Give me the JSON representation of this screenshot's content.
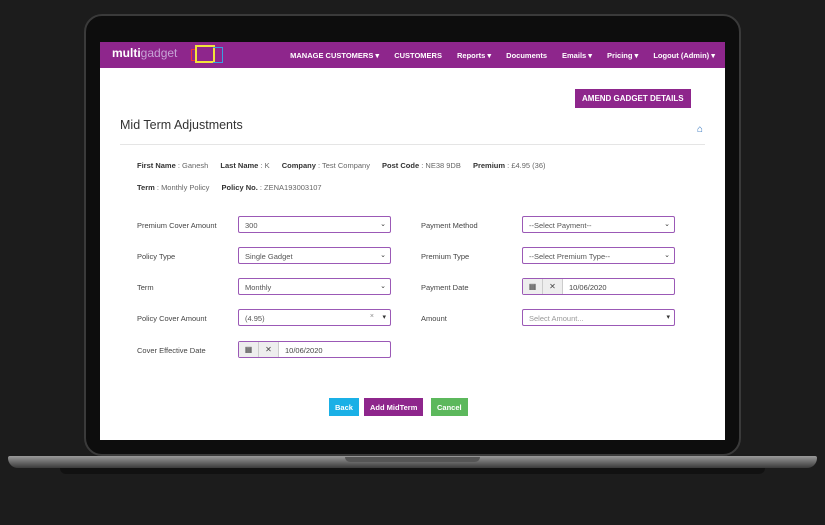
{
  "nav": {
    "logo_main": "multi",
    "logo_sub": "gadget",
    "items": [
      "MANAGE CUSTOMERS ▾",
      "CUSTOMERS",
      "Reports ▾",
      "Documents",
      "Emails ▾",
      "Pricing ▾",
      "Logout (Admin) ▾"
    ]
  },
  "amend_label": "AMEND GADGET DETAILS",
  "title": "Mid Term Adjustments",
  "info": {
    "first_name_label": "First Name",
    "first_name": "Ganesh",
    "last_name_label": "Last Name",
    "last_name": "K",
    "company_label": "Company",
    "company": "Test Company",
    "post_code_label": "Post Code",
    "post_code": "NE38 9DB",
    "premium_label": "Premium",
    "premium": "£4.95 (36)",
    "term_label": "Term",
    "term": "Monthly Policy",
    "policy_no_label": "Policy No.",
    "policy_no": "ZENA193003107"
  },
  "form": {
    "premium_cover_amount_label": "Premium Cover Amount",
    "premium_cover_amount": "300",
    "policy_type_label": "Policy Type",
    "policy_type": "Single Gadget",
    "term_label": "Term",
    "term": "Monthly",
    "policy_cover_amount_label": "Policy Cover Amount",
    "policy_cover_amount": "(4.95)",
    "cover_effective_date_label": "Cover Effective Date",
    "cover_effective_date": "10/06/2020",
    "payment_method_label": "Payment Method",
    "payment_method": "--Select Payment--",
    "premium_type_label": "Premium Type",
    "premium_type": "--Select Premium Type--",
    "payment_date_label": "Payment Date",
    "payment_date": "10/06/2020",
    "amount_label": "Amount",
    "amount_placeholder": "Select Amount..."
  },
  "buttons": {
    "back": "Back",
    "add": "Add MidTerm",
    "cancel": "Cancel"
  },
  "colors": {
    "brand": "#8e268c",
    "back": "#1ab0e6",
    "cancel": "#5cb85c"
  }
}
